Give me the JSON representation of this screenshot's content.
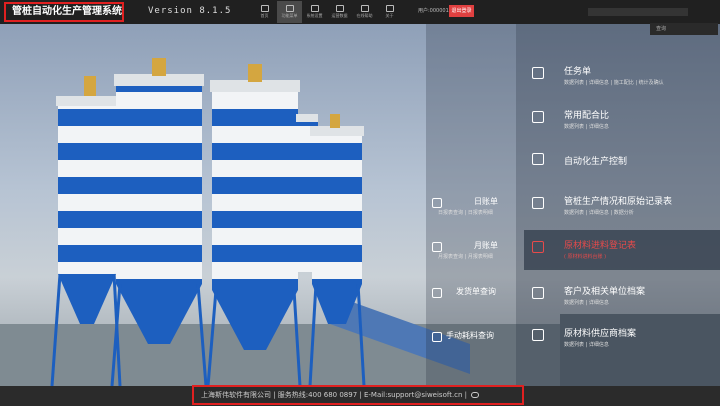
{
  "app": {
    "title": "管桩自动化生产管理系统",
    "version": "Version 8.1.5"
  },
  "toolbar": [
    {
      "label": "首页"
    },
    {
      "label": "功能菜单"
    },
    {
      "label": "系统设置"
    },
    {
      "label": "运营数据"
    },
    {
      "label": "在线帮助"
    },
    {
      "label": "关于"
    }
  ],
  "user": {
    "name": "用户:000001",
    "logout": "退出登录"
  },
  "search": {
    "placeholder": "查询"
  },
  "menu_right": [
    {
      "title": "任务单",
      "sub": "数据列表 | 详细信息 | 施工配比 | 统计及确认"
    },
    {
      "title": "常用配合比",
      "sub": "数据列表 | 详细信息"
    },
    {
      "title": "自动化生产控制",
      "sub": ""
    },
    {
      "title": "管桩生产情况和原始记录表",
      "sub": "数据列表 | 详细信息 | 数据分析"
    },
    {
      "title": "原材料进料登记表",
      "sub": "( 原材料进料台账 )"
    },
    {
      "title": "客户及相关单位档案",
      "sub": "数据列表 | 详细信息"
    },
    {
      "title": "原材料供应商档案",
      "sub": "数据列表 | 详细信息"
    }
  ],
  "menu_mid": [
    {
      "title": "日账单",
      "sub": "日报表查询 | 日报表明细"
    },
    {
      "title": "月账单",
      "sub": "月报表查询 | 月报表明细"
    },
    {
      "title": "发货单查询",
      "sub": ""
    },
    {
      "title": "手动耗料查询",
      "sub": ""
    }
  ],
  "footer": {
    "text": "上海斯伟软件有限公司 | 服务热线:400 680 0897 | E-Mail:support@siweisoft.cn |"
  }
}
